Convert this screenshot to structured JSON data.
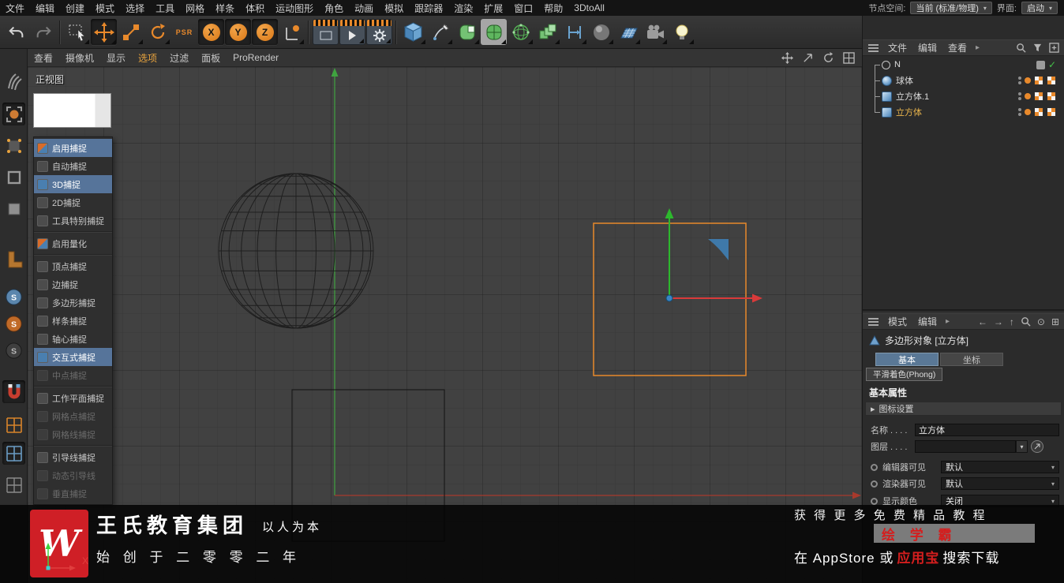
{
  "colors": {
    "accent_orange": "#e8892b",
    "snap_highlight_blue": "#56749a",
    "ad_red": "#d41e1e"
  },
  "menubar": {
    "items": [
      "文件",
      "编辑",
      "创建",
      "模式",
      "选择",
      "工具",
      "网格",
      "样条",
      "体积",
      "运动图形",
      "角色",
      "动画",
      "模拟",
      "跟踪器",
      "渲染",
      "扩展",
      "窗口",
      "帮助",
      "3DtoAll"
    ],
    "node_space_label": "节点空间:",
    "node_space_value": "当前 (标准/物理)",
    "interface_label": "界面:",
    "interface_value": "启动"
  },
  "toolbar": {
    "axis_x": "X",
    "axis_y": "Y",
    "axis_z": "Z",
    "psr": "PSR"
  },
  "viewport": {
    "menu": [
      "查看",
      "摄像机",
      "显示",
      "选项",
      "过滤",
      "面板",
      "ProRender"
    ],
    "view_label": "正视图",
    "axis_x_label": "X"
  },
  "snap_panel": {
    "items": [
      {
        "label": "启用捕捉",
        "state": "active"
      },
      {
        "label": "自动捕捉",
        "state": "normal"
      },
      {
        "label": "3D捕捉",
        "state": "active"
      },
      {
        "label": "2D捕捉",
        "state": "normal"
      },
      {
        "label": "工具特别捕捉",
        "state": "normal"
      },
      {
        "label": "启用量化",
        "state": "normal"
      },
      {
        "label": "顶点捕捉",
        "state": "normal"
      },
      {
        "label": "边捕捉",
        "state": "normal"
      },
      {
        "label": "多边形捕捉",
        "state": "normal"
      },
      {
        "label": "样条捕捉",
        "state": "normal"
      },
      {
        "label": "轴心捕捉",
        "state": "normal"
      },
      {
        "label": "交互式捕捉",
        "state": "active"
      },
      {
        "label": "中点捕捉",
        "state": "disabled"
      },
      {
        "label": "工作平面捕捉",
        "state": "normal"
      },
      {
        "label": "网格点捕捉",
        "state": "disabled"
      },
      {
        "label": "网格线捕捉",
        "state": "disabled"
      },
      {
        "label": "引导线捕捉",
        "state": "normal"
      },
      {
        "label": "动态引导线",
        "state": "disabled"
      },
      {
        "label": "垂直捕捉",
        "state": "disabled"
      }
    ]
  },
  "object_manager": {
    "menus": [
      "文件",
      "编辑",
      "查看"
    ],
    "objects": [
      {
        "name": "N"
      },
      {
        "name": "球体"
      },
      {
        "name": "立方体.1"
      },
      {
        "name": "立方体",
        "selected": true
      }
    ]
  },
  "attributes": {
    "menus": [
      "模式",
      "编辑"
    ],
    "title": "多边形对象 [立方体]",
    "tabs": [
      "基本",
      "坐标"
    ],
    "phong_tab": "平滑着色(Phong)",
    "section": "基本属性",
    "icon_settings": "图标设置",
    "name_label": "名称 . . . .",
    "name_value": "立方体",
    "layer_label": "图层 . . . .",
    "editor_visible_label": "编辑器可见",
    "editor_visible_value": "默认",
    "render_visible_label": "渲染器可见",
    "render_visible_value": "默认",
    "display_color_label": "显示颜色",
    "display_color_value": "关闭"
  },
  "ad": {
    "logo_letter": "W",
    "brand": "王氏教育集团",
    "slogan": "以人为本",
    "tagline": "始 创 于 二 零 零 二 年",
    "line1": "获 得 更 多 免 费 精 品 教 程",
    "line2": "绘 学 霸",
    "line3_pre": "在 AppStore 或",
    "line3_highlight": "应用宝",
    "line3_post": "搜索下载"
  }
}
